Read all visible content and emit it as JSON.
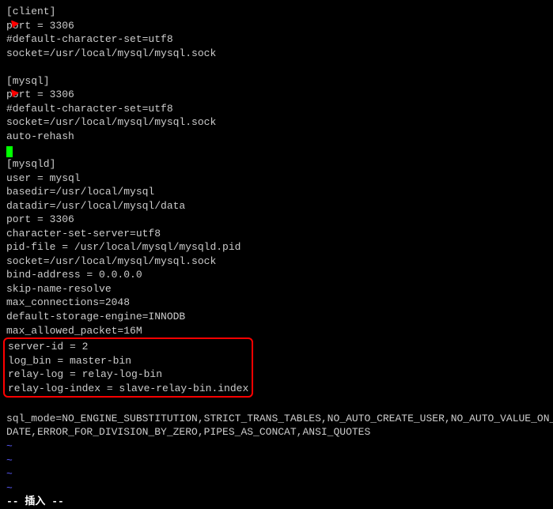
{
  "client_section": {
    "header": "[client]",
    "port_line": "port = 3306",
    "charset_line": "#default-character-set=utf8",
    "socket_line": "socket=/usr/local/mysql/mysql.sock"
  },
  "mysql_section": {
    "header": "[mysql]",
    "port_line": "port = 3306",
    "charset_line": "#default-character-set=utf8",
    "socket_line": "socket=/usr/local/mysql/mysql.sock",
    "autorehash_line": "auto-rehash"
  },
  "mysqld_section": {
    "header": "[mysqld]",
    "user_line": "user = mysql",
    "basedir_line": "basedir=/usr/local/mysql",
    "datadir_line": "datadir=/usr/local/mysql/data",
    "port_line": "port = 3306",
    "charset_line": "character-set-server=utf8",
    "pidfile_line": "pid-file = /usr/local/mysql/mysqld.pid",
    "socket_line": "socket=/usr/local/mysql/mysql.sock",
    "bindaddr_line": "bind-address = 0.0.0.0",
    "skipname_line": "skip-name-resolve",
    "maxconn_line": "max_connections=2048",
    "engine_line": "default-storage-engine=INNODB",
    "maxpacket_line": "max_allowed_packet=16M"
  },
  "highlighted": {
    "serverid_line": "server-id = 2",
    "logbin_line": "log_bin = master-bin",
    "relaylog_line": "relay-log = relay-log-bin",
    "relayidx_line": "relay-log-index = slave-relay-bin.index"
  },
  "sqlmode": {
    "line1": "sql_mode=NO_ENGINE_SUBSTITUTION,STRICT_TRANS_TABLES,NO_AUTO_CREATE_USER,NO_AUTO_VALUE_ON_ZERO,NO_ZE",
    "line2": "DATE,ERROR_FOR_DIVISION_BY_ZERO,PIPES_AS_CONCAT,ANSI_QUOTES"
  },
  "vim": {
    "tilde": "~",
    "status": "-- 插入 --"
  }
}
